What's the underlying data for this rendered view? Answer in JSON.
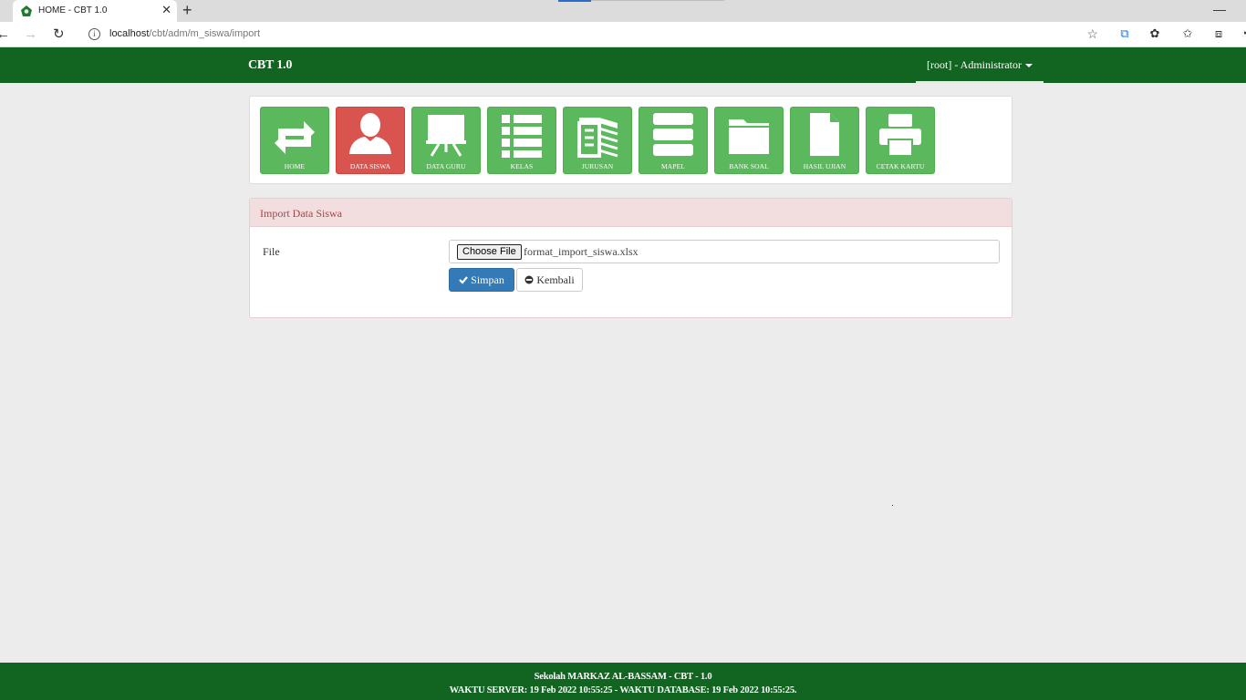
{
  "browser": {
    "tab_title": "HOME - CBT 1.0",
    "url_host": "localhost",
    "url_path": "/cbt/adm/m_siswa/import",
    "tab_icon": "green-leaf-favicon"
  },
  "navbar": {
    "brand": "CBT 1.0",
    "user_label": "[root] - Administrator"
  },
  "menu": {
    "items": [
      {
        "label": "HOME",
        "icon": "refresh-icon",
        "active": false
      },
      {
        "label": "DATA SISWA",
        "icon": "user-icon",
        "active": true
      },
      {
        "label": "DATA GURU",
        "icon": "blackboard-icon",
        "active": false
      },
      {
        "label": "KELAS",
        "icon": "list-icon",
        "active": false
      },
      {
        "label": "JURUSAN",
        "icon": "book-icon",
        "active": false
      },
      {
        "label": "MAPEL",
        "icon": "tasks-icon",
        "active": false
      },
      {
        "label": "BANK SOAL",
        "icon": "folder-icon",
        "active": false
      },
      {
        "label": "HASIL UJIAN",
        "icon": "file-icon",
        "active": false
      },
      {
        "label": "CETAK KARTU",
        "icon": "print-icon",
        "active": false
      }
    ]
  },
  "import_panel": {
    "heading": "Import Data Siswa",
    "file_label": "File",
    "choose_button": "Choose File",
    "file_name": "format_import_siswa.xlsx",
    "save_button": "Simpan",
    "back_button": "Kembali"
  },
  "footer": {
    "line1": "Sekolah MARKAZ AL-BASSAM - CBT - 1.0",
    "line2": "WAKTU SERVER: 19 Feb 2022 10:55:25 - WAKTU DATABASE: 19 Feb 2022 10:55:25."
  },
  "colors": {
    "navbar": "#126520",
    "tile_green": "#5cb85c",
    "tile_active": "#d9534f",
    "primary_button": "#337ab7",
    "panel_heading": "#f2dede"
  }
}
